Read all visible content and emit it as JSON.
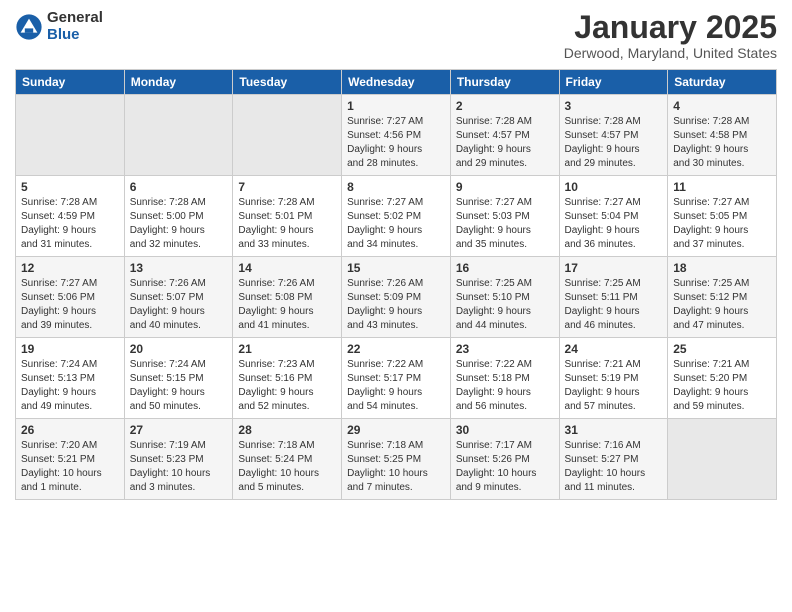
{
  "header": {
    "logo_general": "General",
    "logo_blue": "Blue",
    "month_title": "January 2025",
    "location": "Derwood, Maryland, United States"
  },
  "days_of_week": [
    "Sunday",
    "Monday",
    "Tuesday",
    "Wednesday",
    "Thursday",
    "Friday",
    "Saturday"
  ],
  "weeks": [
    [
      {
        "day": "",
        "info": ""
      },
      {
        "day": "",
        "info": ""
      },
      {
        "day": "",
        "info": ""
      },
      {
        "day": "1",
        "info": "Sunrise: 7:27 AM\nSunset: 4:56 PM\nDaylight: 9 hours\nand 28 minutes."
      },
      {
        "day": "2",
        "info": "Sunrise: 7:28 AM\nSunset: 4:57 PM\nDaylight: 9 hours\nand 29 minutes."
      },
      {
        "day": "3",
        "info": "Sunrise: 7:28 AM\nSunset: 4:57 PM\nDaylight: 9 hours\nand 29 minutes."
      },
      {
        "day": "4",
        "info": "Sunrise: 7:28 AM\nSunset: 4:58 PM\nDaylight: 9 hours\nand 30 minutes."
      }
    ],
    [
      {
        "day": "5",
        "info": "Sunrise: 7:28 AM\nSunset: 4:59 PM\nDaylight: 9 hours\nand 31 minutes."
      },
      {
        "day": "6",
        "info": "Sunrise: 7:28 AM\nSunset: 5:00 PM\nDaylight: 9 hours\nand 32 minutes."
      },
      {
        "day": "7",
        "info": "Sunrise: 7:28 AM\nSunset: 5:01 PM\nDaylight: 9 hours\nand 33 minutes."
      },
      {
        "day": "8",
        "info": "Sunrise: 7:27 AM\nSunset: 5:02 PM\nDaylight: 9 hours\nand 34 minutes."
      },
      {
        "day": "9",
        "info": "Sunrise: 7:27 AM\nSunset: 5:03 PM\nDaylight: 9 hours\nand 35 minutes."
      },
      {
        "day": "10",
        "info": "Sunrise: 7:27 AM\nSunset: 5:04 PM\nDaylight: 9 hours\nand 36 minutes."
      },
      {
        "day": "11",
        "info": "Sunrise: 7:27 AM\nSunset: 5:05 PM\nDaylight: 9 hours\nand 37 minutes."
      }
    ],
    [
      {
        "day": "12",
        "info": "Sunrise: 7:27 AM\nSunset: 5:06 PM\nDaylight: 9 hours\nand 39 minutes."
      },
      {
        "day": "13",
        "info": "Sunrise: 7:26 AM\nSunset: 5:07 PM\nDaylight: 9 hours\nand 40 minutes."
      },
      {
        "day": "14",
        "info": "Sunrise: 7:26 AM\nSunset: 5:08 PM\nDaylight: 9 hours\nand 41 minutes."
      },
      {
        "day": "15",
        "info": "Sunrise: 7:26 AM\nSunset: 5:09 PM\nDaylight: 9 hours\nand 43 minutes."
      },
      {
        "day": "16",
        "info": "Sunrise: 7:25 AM\nSunset: 5:10 PM\nDaylight: 9 hours\nand 44 minutes."
      },
      {
        "day": "17",
        "info": "Sunrise: 7:25 AM\nSunset: 5:11 PM\nDaylight: 9 hours\nand 46 minutes."
      },
      {
        "day": "18",
        "info": "Sunrise: 7:25 AM\nSunset: 5:12 PM\nDaylight: 9 hours\nand 47 minutes."
      }
    ],
    [
      {
        "day": "19",
        "info": "Sunrise: 7:24 AM\nSunset: 5:13 PM\nDaylight: 9 hours\nand 49 minutes."
      },
      {
        "day": "20",
        "info": "Sunrise: 7:24 AM\nSunset: 5:15 PM\nDaylight: 9 hours\nand 50 minutes."
      },
      {
        "day": "21",
        "info": "Sunrise: 7:23 AM\nSunset: 5:16 PM\nDaylight: 9 hours\nand 52 minutes."
      },
      {
        "day": "22",
        "info": "Sunrise: 7:22 AM\nSunset: 5:17 PM\nDaylight: 9 hours\nand 54 minutes."
      },
      {
        "day": "23",
        "info": "Sunrise: 7:22 AM\nSunset: 5:18 PM\nDaylight: 9 hours\nand 56 minutes."
      },
      {
        "day": "24",
        "info": "Sunrise: 7:21 AM\nSunset: 5:19 PM\nDaylight: 9 hours\nand 57 minutes."
      },
      {
        "day": "25",
        "info": "Sunrise: 7:21 AM\nSunset: 5:20 PM\nDaylight: 9 hours\nand 59 minutes."
      }
    ],
    [
      {
        "day": "26",
        "info": "Sunrise: 7:20 AM\nSunset: 5:21 PM\nDaylight: 10 hours\nand 1 minute."
      },
      {
        "day": "27",
        "info": "Sunrise: 7:19 AM\nSunset: 5:23 PM\nDaylight: 10 hours\nand 3 minutes."
      },
      {
        "day": "28",
        "info": "Sunrise: 7:18 AM\nSunset: 5:24 PM\nDaylight: 10 hours\nand 5 minutes."
      },
      {
        "day": "29",
        "info": "Sunrise: 7:18 AM\nSunset: 5:25 PM\nDaylight: 10 hours\nand 7 minutes."
      },
      {
        "day": "30",
        "info": "Sunrise: 7:17 AM\nSunset: 5:26 PM\nDaylight: 10 hours\nand 9 minutes."
      },
      {
        "day": "31",
        "info": "Sunrise: 7:16 AM\nSunset: 5:27 PM\nDaylight: 10 hours\nand 11 minutes."
      },
      {
        "day": "",
        "info": ""
      }
    ]
  ]
}
